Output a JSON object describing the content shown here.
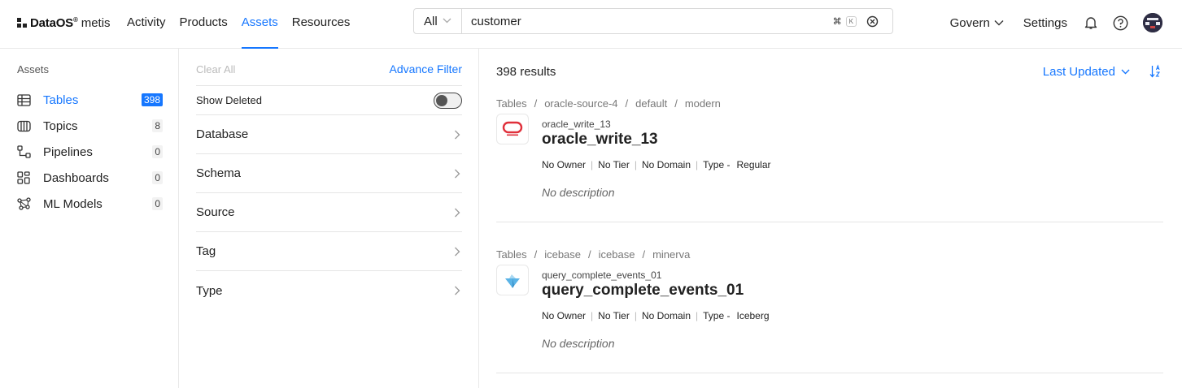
{
  "header": {
    "logo": {
      "brand": "DataOS",
      "reg": "®",
      "product": "metis"
    },
    "nav": [
      {
        "label": "Activity",
        "active": false
      },
      {
        "label": "Products",
        "active": false
      },
      {
        "label": "Assets",
        "active": true
      },
      {
        "label": "Resources",
        "active": false
      }
    ],
    "search": {
      "scope": "All",
      "value": "customer",
      "shortcut_mod": "⌘",
      "shortcut_key": "K"
    },
    "govern_label": "Govern",
    "settings_label": "Settings",
    "icons": [
      "bell-icon",
      "help-icon",
      "avatar"
    ]
  },
  "sidebar": {
    "title": "Assets",
    "items": [
      {
        "label": "Tables",
        "count": "398",
        "icon": "table-icon",
        "active": true
      },
      {
        "label": "Topics",
        "count": "8",
        "icon": "topic-icon",
        "active": false
      },
      {
        "label": "Pipelines",
        "count": "0",
        "icon": "pipeline-icon",
        "active": false
      },
      {
        "label": "Dashboards",
        "count": "0",
        "icon": "dashboard-icon",
        "active": false
      },
      {
        "label": "ML Models",
        "count": "0",
        "icon": "ml-model-icon",
        "active": false
      }
    ]
  },
  "filters": {
    "clear_all": "Clear All",
    "advance_filter": "Advance Filter",
    "show_deleted": "Show Deleted",
    "show_deleted_on": false,
    "facets": [
      "Database",
      "Schema",
      "Source",
      "Tag",
      "Type"
    ]
  },
  "results": {
    "count_label": "398 results",
    "sort_label": "Last Updated",
    "items": [
      {
        "crumbs": [
          "Tables",
          "oracle-source-4",
          "default",
          "modern"
        ],
        "logo": "oracle-logo",
        "subtitle": "oracle_write_13",
        "title": "oracle_write_13",
        "owner": "No Owner",
        "tier": "No Tier",
        "domain": "No Domain",
        "type_label": "Type -",
        "type_value": "Regular",
        "description": "No description"
      },
      {
        "crumbs": [
          "Tables",
          "icebase",
          "icebase",
          "minerva"
        ],
        "logo": "iceberg-logo",
        "subtitle": "query_complete_events_01",
        "title": "query_complete_events_01",
        "owner": "No Owner",
        "tier": "No Tier",
        "domain": "No Domain",
        "type_label": "Type -",
        "type_value": "Iceberg",
        "description": "No description"
      }
    ]
  },
  "colors": {
    "accent": "#1677ff",
    "oracle": "#e0303b",
    "iceberg": "#5ab3e6"
  }
}
